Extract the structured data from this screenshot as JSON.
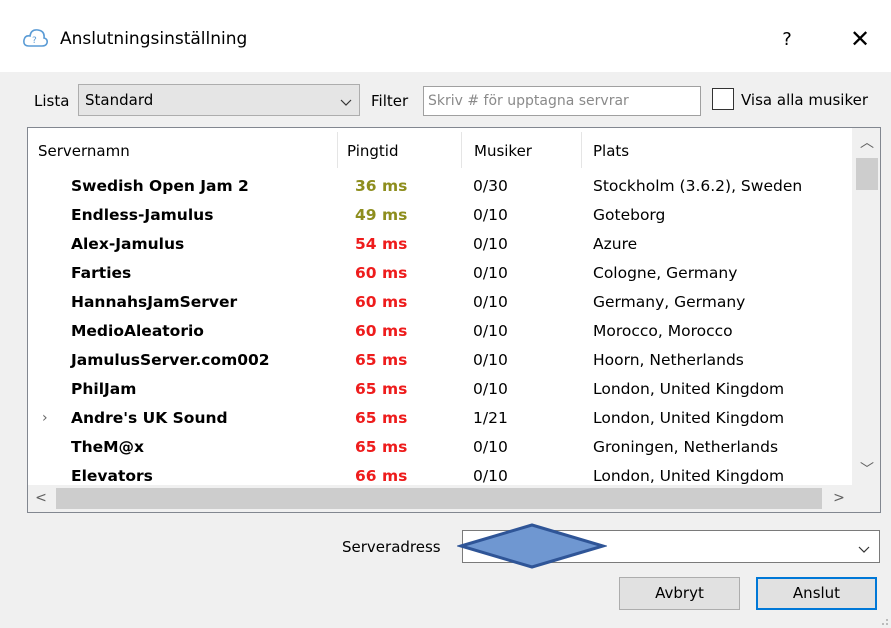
{
  "window": {
    "title": "Anslutningsinställning",
    "help_label": "?",
    "close_label": "✕",
    "icon": "cloud-music-icon"
  },
  "toolbar": {
    "list_label": "Lista",
    "list_value": "Standard",
    "filter_label": "Filter",
    "filter_placeholder": "Skriv # för upptagna servrar",
    "show_all_label": "Visa alla musiker",
    "show_all_checked": false
  },
  "table": {
    "columns": [
      "Servernamn",
      "Pingtid",
      "Musiker",
      "Plats"
    ],
    "rows": [
      {
        "name": "Swedish Open Jam 2",
        "ping": "36 ms",
        "ping_status": "good",
        "musicians": "0/30",
        "location": "Stockholm (3.6.2), Sweden",
        "expandable": false
      },
      {
        "name": "Endless-Jamulus",
        "ping": "49 ms",
        "ping_status": "good",
        "musicians": "0/10",
        "location": "Goteborg",
        "expandable": false
      },
      {
        "name": "Alex-Jamulus",
        "ping": "54 ms",
        "ping_status": "bad",
        "musicians": "0/10",
        "location": "Azure",
        "expandable": false
      },
      {
        "name": "Farties",
        "ping": "60 ms",
        "ping_status": "bad",
        "musicians": "0/10",
        "location": "Cologne, Germany",
        "expandable": false
      },
      {
        "name": "HannahsJamServer",
        "ping": "60 ms",
        "ping_status": "bad",
        "musicians": "0/10",
        "location": "Germany, Germany",
        "expandable": false
      },
      {
        "name": "MedioAleatorio",
        "ping": "60 ms",
        "ping_status": "bad",
        "musicians": "0/10",
        "location": "Morocco, Morocco",
        "expandable": false
      },
      {
        "name": "JamulusServer.com002",
        "ping": "65 ms",
        "ping_status": "bad",
        "musicians": "0/10",
        "location": "Hoorn, Netherlands",
        "expandable": false
      },
      {
        "name": "PhilJam",
        "ping": "65 ms",
        "ping_status": "bad",
        "musicians": "0/10",
        "location": "London, United Kingdom",
        "expandable": false
      },
      {
        "name": "Andre's UK Sound",
        "ping": "65 ms",
        "ping_status": "bad",
        "musicians": "1/21",
        "location": "London, United Kingdom",
        "expandable": true
      },
      {
        "name": "TheM@x",
        "ping": "65 ms",
        "ping_status": "bad",
        "musicians": "0/10",
        "location": "Groningen, Netherlands",
        "expandable": false
      },
      {
        "name": "Elevators",
        "ping": "66 ms",
        "ping_status": "bad",
        "musicians": "0/10",
        "location": "London, United Kingdom",
        "expandable": false
      }
    ]
  },
  "address": {
    "label": "Serveradress",
    "value": ""
  },
  "buttons": {
    "cancel": "Avbryt",
    "connect": "Anslut"
  },
  "colors": {
    "ping_good": "#8e8e1e",
    "ping_bad": "#ee1c1c",
    "overlay_fill": "#6f97d1",
    "overlay_stroke": "#2f5597"
  }
}
